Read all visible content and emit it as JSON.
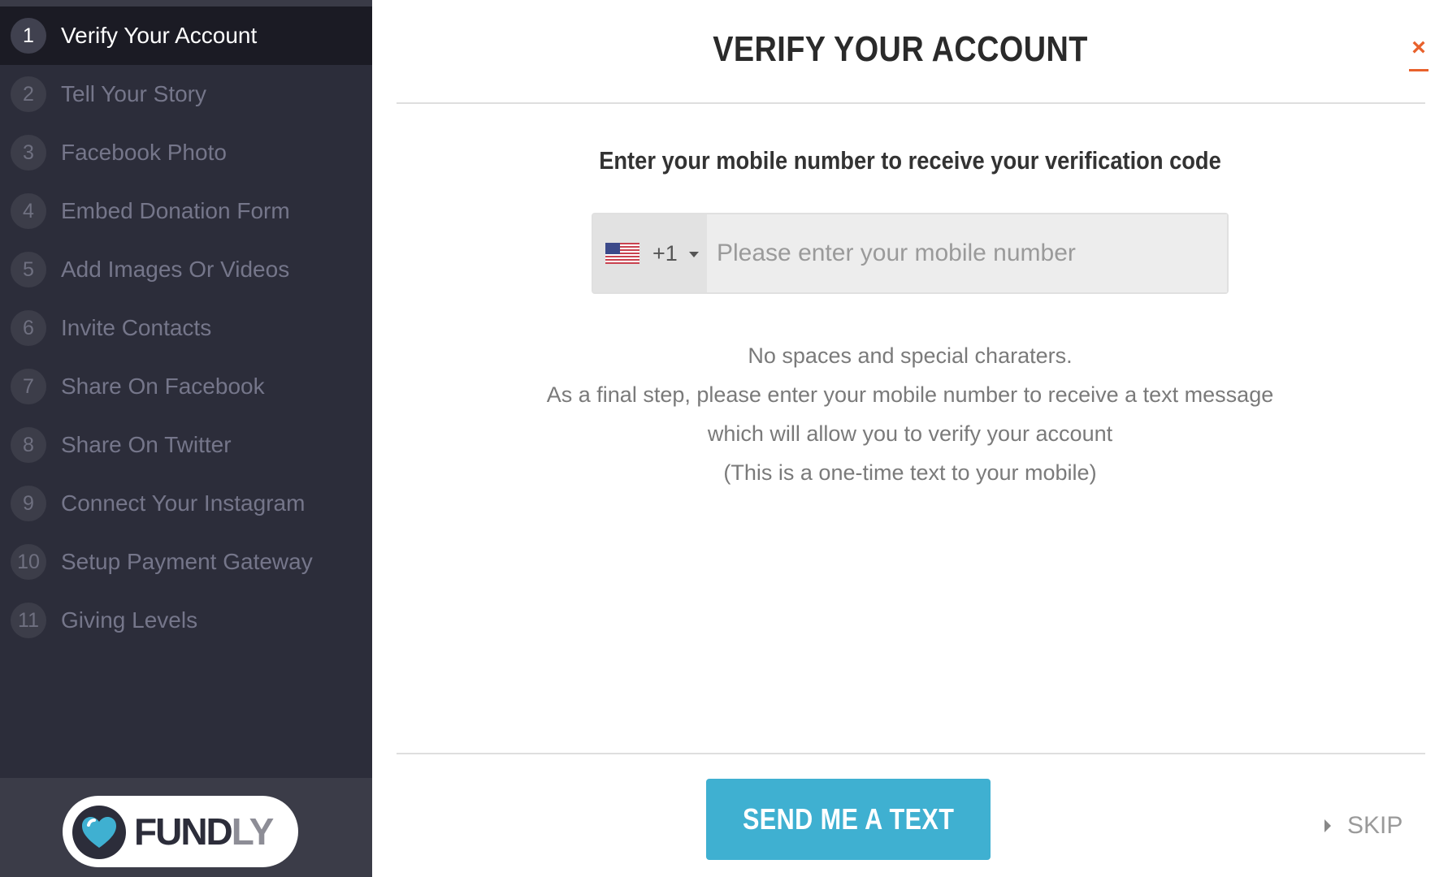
{
  "sidebar": {
    "steps": [
      {
        "number": "1",
        "label": "Verify Your Account",
        "active": true
      },
      {
        "number": "2",
        "label": "Tell Your Story"
      },
      {
        "number": "3",
        "label": "Facebook Photo"
      },
      {
        "number": "4",
        "label": "Embed Donation Form"
      },
      {
        "number": "5",
        "label": "Add Images Or Videos"
      },
      {
        "number": "6",
        "label": "Invite Contacts"
      },
      {
        "number": "7",
        "label": "Share On Facebook"
      },
      {
        "number": "8",
        "label": "Share On Twitter"
      },
      {
        "number": "9",
        "label": "Connect Your Instagram"
      },
      {
        "number": "10",
        "label": "Setup Payment Gateway"
      },
      {
        "number": "11",
        "label": "Giving Levels"
      }
    ],
    "logo": {
      "text_main": "FUND",
      "text_accent": "LY",
      "icon": "heart-icon"
    }
  },
  "main": {
    "title": "VERIFY YOUR ACCOUNT",
    "close_label": "×",
    "subheading": "Enter your mobile number to receive your verification code",
    "phone": {
      "country_flag": "us-flag-icon",
      "dial_code": "+1",
      "placeholder": "Please enter your mobile number",
      "value": ""
    },
    "help_lines": [
      "No spaces and special charaters.",
      "As a final step, please enter your mobile number to receive a text message",
      "which will allow you to verify your account",
      "(This is a one-time text to your mobile)"
    ],
    "send_button": "SEND ME A TEXT",
    "skip_label": "SKIP"
  },
  "colors": {
    "sidebar_bg": "#2c2d3a",
    "active_step_bg": "#1b1b24",
    "accent_close": "#e8612c",
    "button_bg": "#3fb0d1",
    "logo_heart": "#3fb0d1"
  }
}
